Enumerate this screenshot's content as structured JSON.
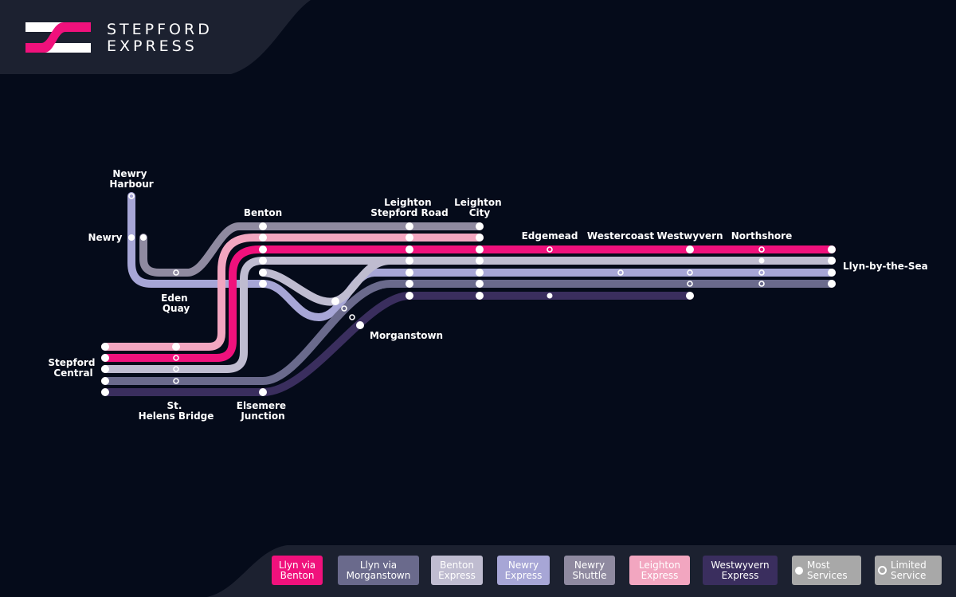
{
  "brand": {
    "line1": "STEPFORD",
    "line2": "EXPRESS"
  },
  "colors": {
    "background": "#050b1a",
    "header_panel": "#1c2130",
    "llyn_via_benton": "#f0117c",
    "llyn_via_morganstown": "#6a6a8c",
    "benton_express": "#bfbcd0",
    "newry_express": "#a7a6d6",
    "newry_shuttle": "#8f8aa0",
    "leighton_express": "#f2a6c0",
    "westwyvern_express": "#3a2e5e",
    "most_services": "#ffffff",
    "limited_service": "#ffffff"
  },
  "stations": {
    "newry_harbour": "Newry Harbour",
    "newry": "Newry",
    "eden_quay": "Eden Quay",
    "benton": "Benton",
    "leighton_stepford_road": "Leighton Stepford Road",
    "leighton_city": "Leighton City",
    "edgemead": "Edgemead",
    "westercoast": "Westercoast",
    "westwyvern": "Westwyvern",
    "northshore": "Northshore",
    "llyn_by_the_sea": "Llyn-by-the-Sea",
    "morganstown": "Morganstown",
    "stepford_central": "Stepford Central",
    "st_helens_bridge": "St. Helens Bridge",
    "elsemere_junction": "Elsemere Junction"
  },
  "legend": [
    {
      "id": "llyn_via_benton",
      "label": "Llyn via Benton",
      "color": "#f0117c",
      "text_color": "#ffffff"
    },
    {
      "id": "llyn_via_morganstown",
      "label": "Llyn via Morganstown",
      "color": "#6a6a8c",
      "text_color": "#ffffff"
    },
    {
      "id": "benton_express",
      "label": "Benton Express",
      "color": "#bfbcd0",
      "text_color": "#ffffff"
    },
    {
      "id": "newry_express",
      "label": "Newry Express",
      "color": "#a7a6d6",
      "text_color": "#ffffff"
    },
    {
      "id": "newry_shuttle",
      "label": "Newry Shuttle",
      "color": "#8f8aa0",
      "text_color": "#ffffff"
    },
    {
      "id": "leighton_express",
      "label": "Leighton Express",
      "color": "#f2a6c0",
      "text_color": "#ffffff"
    },
    {
      "id": "westwyvern_express",
      "label": "Westwyvern Express",
      "color": "#3a2e5e",
      "text_color": "#ffffff"
    },
    {
      "id": "most_services",
      "label": "Most Services",
      "color": "#a8a8a8",
      "text_color": "#ffffff",
      "marker": "full"
    },
    {
      "id": "limited_service",
      "label": "Limited Service",
      "color": "#a8a8a8",
      "text_color": "#ffffff",
      "marker": "ring"
    }
  ]
}
